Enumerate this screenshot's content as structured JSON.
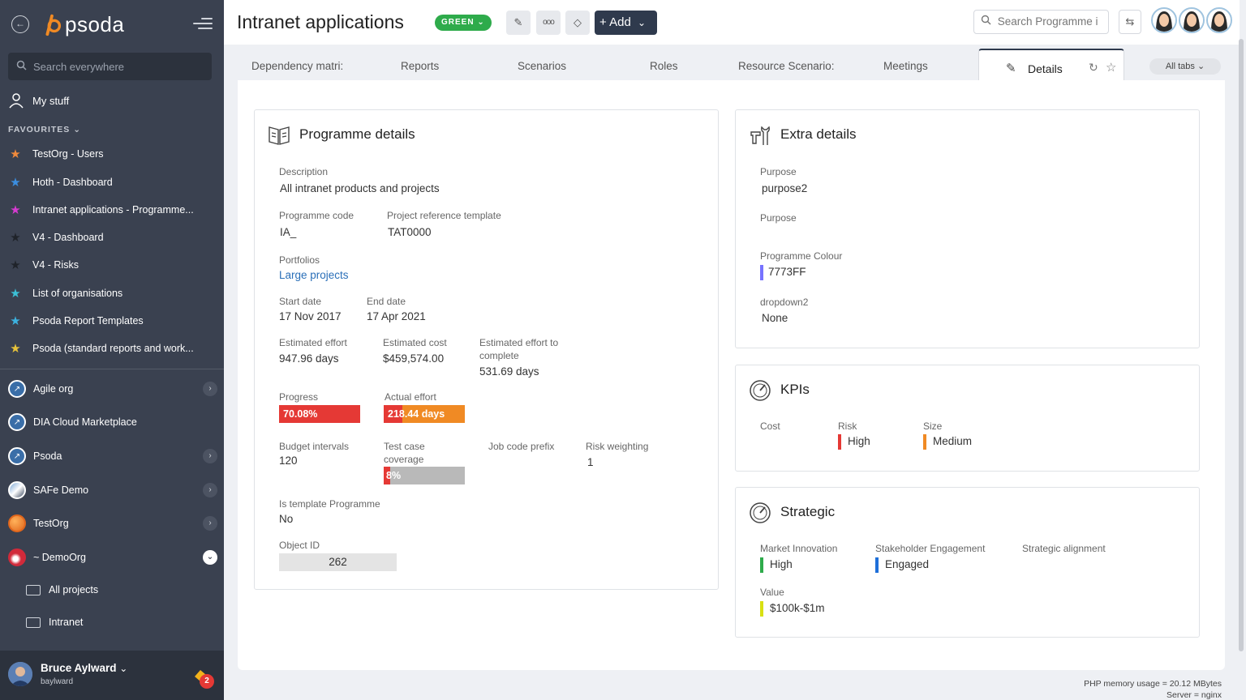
{
  "app": {
    "logo_text": "psoda"
  },
  "sidebar": {
    "search_placeholder": "Search everywhere",
    "my_stuff": "My stuff",
    "favourites_heading": "FAVOURITES",
    "favourites": [
      {
        "label": "TestOrg - Users",
        "color": "#f08a3c"
      },
      {
        "label": "Hoth - Dashboard",
        "color": "#3b8ee0"
      },
      {
        "label": "Intranet applications - Programme...",
        "color": "#d63bd1"
      },
      {
        "label": "V4 - Dashboard",
        "color": "#2b2f36"
      },
      {
        "label": "V4 - Risks",
        "color": "#2b2f36"
      },
      {
        "label": "List of organisations",
        "color": "#3cc0d6"
      },
      {
        "label": "Psoda Report Templates",
        "color": "#3cb2e0"
      },
      {
        "label": "Psoda (standard reports and work...",
        "color": "#e8c33a"
      }
    ],
    "orgs": [
      {
        "label": "Agile org",
        "expand": "›"
      },
      {
        "label": "DIA Cloud Marketplace",
        "expand": ""
      },
      {
        "label": "Psoda",
        "expand": "›"
      },
      {
        "label": "SAFe Demo",
        "expand": "›"
      },
      {
        "label": "TestOrg",
        "expand": "›"
      },
      {
        "label": "~ DemoOrg",
        "expand": "⌄"
      }
    ],
    "sub_items": [
      "All projects",
      "Intranet"
    ],
    "user": {
      "name": "Bruce Aylward",
      "login": "baylward",
      "notifications": "2"
    }
  },
  "header": {
    "title": "Intranet applications",
    "status": "GREEN",
    "add_label": "Add",
    "search_placeholder": "Search Programme i"
  },
  "tabs": {
    "items": [
      "Dependency matri:",
      "Reports",
      "Scenarios",
      "Roles",
      "Resource Scenario:",
      "Meetings"
    ],
    "active": "Details",
    "all_tabs": "All tabs"
  },
  "programme_details": {
    "title": "Programme details",
    "description_label": "Description",
    "description": "All intranet products and projects",
    "code_label": "Programme code",
    "code": "IA_",
    "template_label": "Project reference template",
    "template": "TAT0000",
    "portfolios_label": "Portfolios",
    "portfolios": "Large projects",
    "start_label": "Start date",
    "start": "17 Nov 2017",
    "end_label": "End date",
    "end": "17 Apr 2021",
    "effort_label": "Estimated effort",
    "effort": "947.96 days",
    "cost_label": "Estimated cost",
    "cost": "$459,574.00",
    "etc_label_1": "Estimated effort to",
    "etc_label_2": "complete",
    "etc": "531.69 days",
    "progress_label": "Progress",
    "progress": "70.08%",
    "progress_fraction": 1.0,
    "actual_label": "Actual effort",
    "actual": "218.44 days",
    "actual_fraction": 0.23,
    "budget_label": "Budget intervals",
    "budget": "120",
    "coverage_label_1": "Test case",
    "coverage_label_2": "coverage",
    "coverage": "8%",
    "coverage_fraction": 0.08,
    "job_label": "Job code prefix",
    "risk_label": "Risk weighting",
    "risk": "1",
    "template_flag_label": "Is template Programme",
    "template_flag": "No",
    "object_label": "Object ID",
    "object_id": "262"
  },
  "extra_details": {
    "title": "Extra details",
    "purpose_label": "Purpose",
    "purpose": "purpose2",
    "purpose2_label": "Purpose",
    "colour_label": "Programme Colour",
    "colour": "7773FF",
    "colour_hex": "#7773FF",
    "dropdown_label": "dropdown2",
    "dropdown": "None"
  },
  "kpis": {
    "title": "KPIs",
    "cost_label": "Cost",
    "risk_label": "Risk",
    "risk": "High",
    "risk_color": "#e53935",
    "size_label": "Size",
    "size": "Medium",
    "size_color": "#f08a24"
  },
  "strategic": {
    "title": "Strategic",
    "market_label": "Market Innovation",
    "market": "High",
    "market_color": "#2eab4b",
    "stake_label": "Stakeholder Engagement",
    "stake": "Engaged",
    "stake_color": "#1e6fd9",
    "align_label": "Strategic alignment",
    "value_label": "Value",
    "value": "$100k-$1m",
    "value_color": "#d8e012"
  },
  "footer": {
    "memory": "PHP memory usage = 20.12 MBytes",
    "server": "Server = nginx"
  }
}
